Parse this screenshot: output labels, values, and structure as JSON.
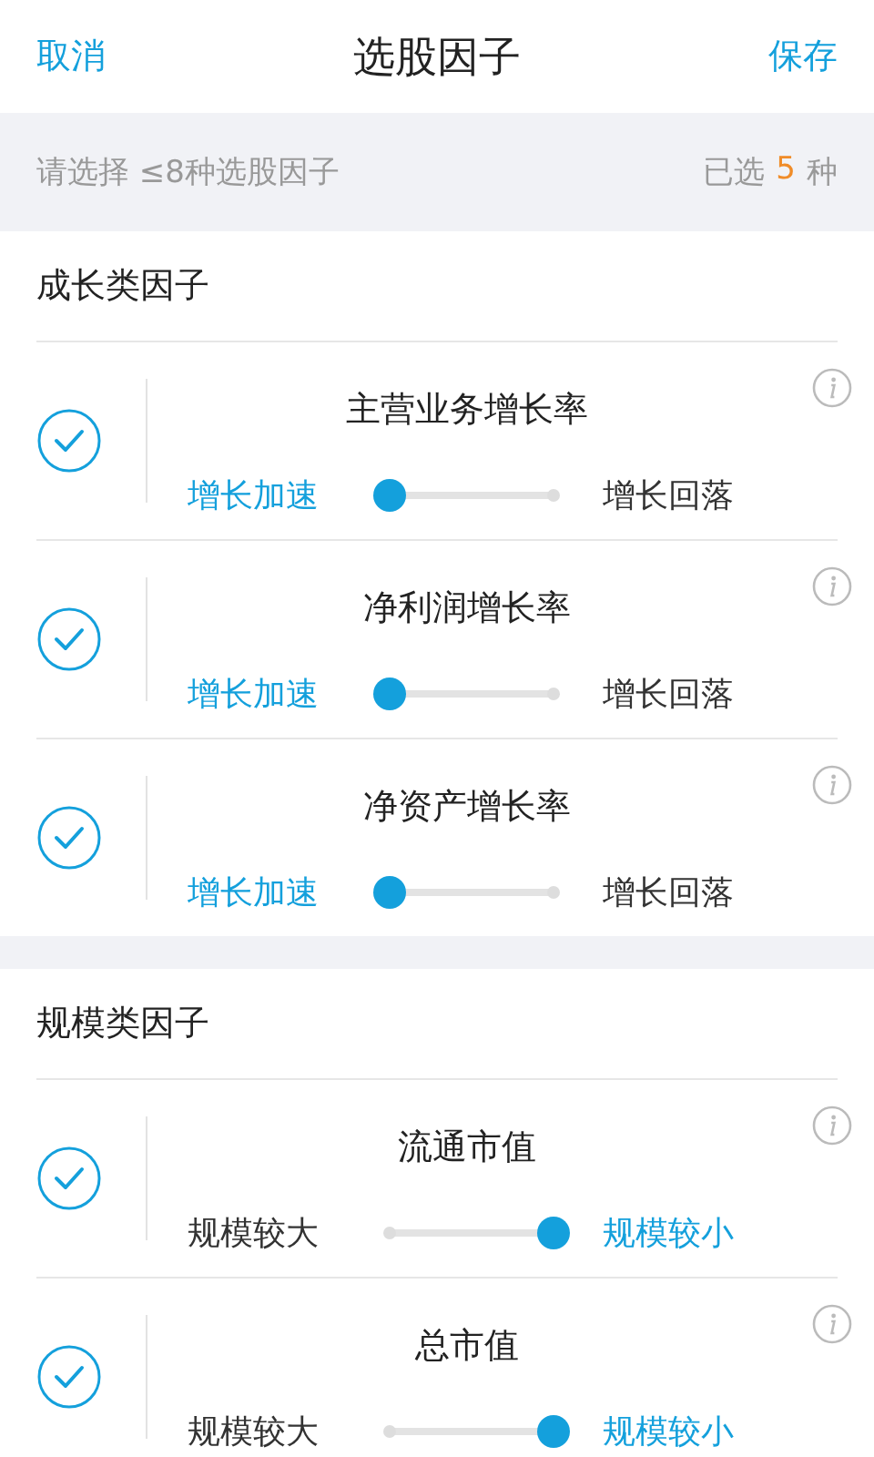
{
  "header": {
    "cancel": "取消",
    "title": "选股因子",
    "save": "保存"
  },
  "notice": {
    "hint": "请选择 ≤8种选股因子",
    "selected_prefix": "已选",
    "selected_count": "5",
    "selected_suffix": "种"
  },
  "sections": [
    {
      "title": "成长类因子",
      "factors": [
        {
          "name": "主营业务增长率",
          "checked": true,
          "left_label": "增长加速",
          "right_label": "增长回落",
          "level": 0
        },
        {
          "name": "净利润增长率",
          "checked": true,
          "left_label": "增长加速",
          "right_label": "增长回落",
          "level": 0
        },
        {
          "name": "净资产增长率",
          "checked": true,
          "left_label": "增长加速",
          "right_label": "增长回落",
          "level": 0
        }
      ]
    },
    {
      "title": "规模类因子",
      "factors": [
        {
          "name": "流通市值",
          "checked": true,
          "left_label": "规模较大",
          "right_label": "规模较小",
          "level": 1
        },
        {
          "name": "总市值",
          "checked": true,
          "left_label": "规模较大",
          "right_label": "规模较小",
          "level": 1
        }
      ]
    }
  ]
}
